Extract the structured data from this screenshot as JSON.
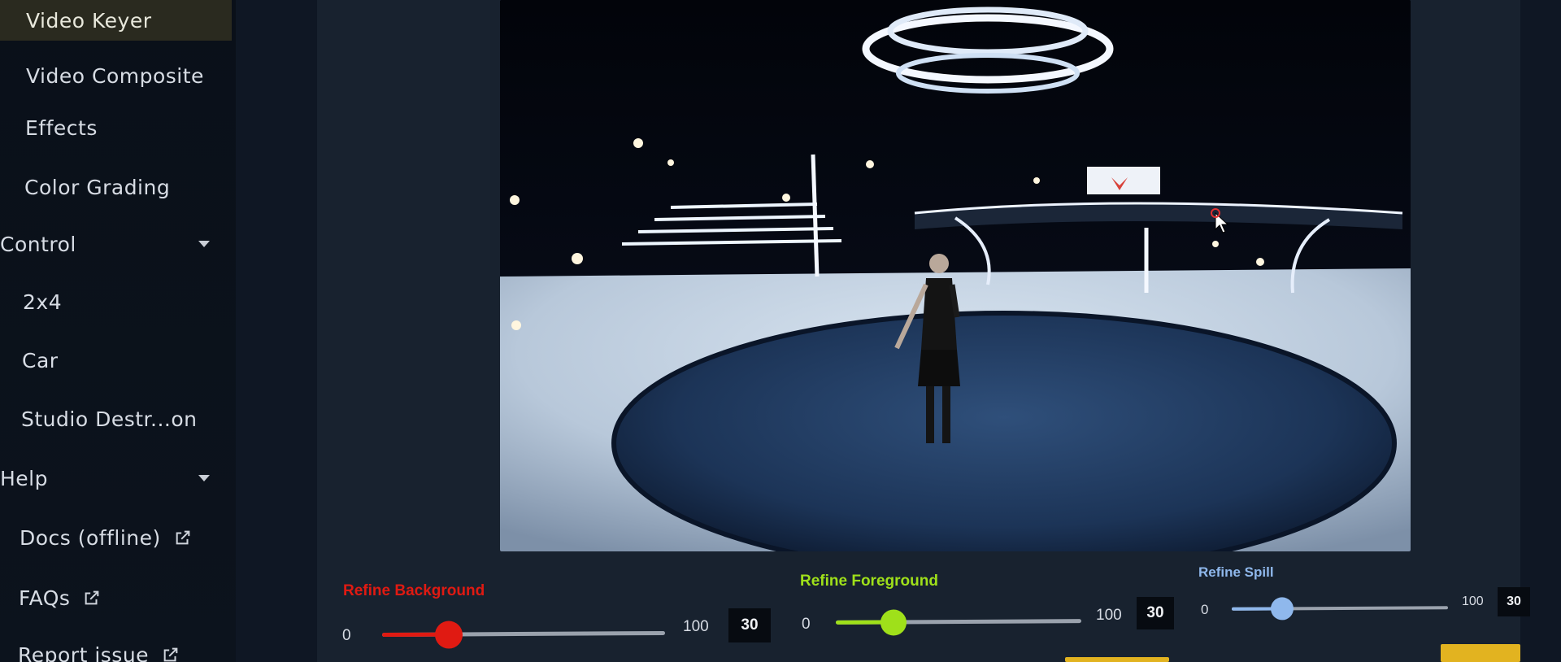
{
  "sidebar": {
    "items": [
      {
        "label": "Video Keyer",
        "active": true
      },
      {
        "label": "Video Composite"
      },
      {
        "label": "Effects"
      },
      {
        "label": "Color Grading"
      },
      {
        "label": "Control",
        "section": true
      },
      {
        "label": "2x4"
      },
      {
        "label": "Car"
      },
      {
        "label": "Studio Destr...on"
      },
      {
        "label": "Help",
        "section": true
      },
      {
        "label": "Docs (offline)",
        "external": true
      },
      {
        "label": "FAQs",
        "external": true
      },
      {
        "label": "Report issue",
        "external": true
      }
    ]
  },
  "sliders": {
    "background": {
      "label": "Refine Background",
      "min": "0",
      "max": "100",
      "value": "30",
      "color": "#e01a12"
    },
    "foreground": {
      "label": "Refine Foreground",
      "min": "0",
      "max": "100",
      "value": "30",
      "color": "#9fe01a"
    },
    "spill": {
      "label": "Refine Spill",
      "min": "0",
      "max": "100",
      "value": "30",
      "color": "#8fb8ec"
    }
  },
  "colors": {
    "accent_yellow": "#e2b320",
    "panel": "#18222f",
    "sidebar": "#0a1019"
  }
}
